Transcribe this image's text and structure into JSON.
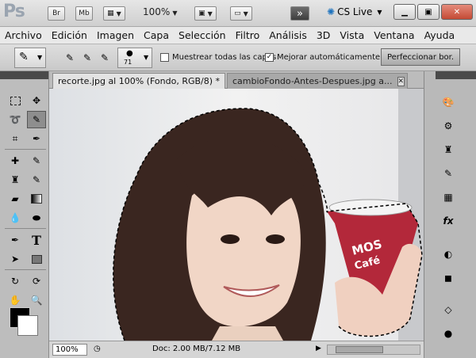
{
  "app": {
    "logo": "Ps",
    "buttons": [
      "Br",
      "Mb"
    ],
    "zoom": "100%",
    "cslive": "CS Live"
  },
  "menu": [
    "Archivo",
    "Edición",
    "Imagen",
    "Capa",
    "Selección",
    "Filtro",
    "Análisis",
    "3D",
    "Vista",
    "Ventana",
    "Ayuda"
  ],
  "options": {
    "brush_size": "71",
    "sample_all_layers": "Muestrear todas las capas",
    "auto_enhance": "Mejorar automáticamente",
    "refine_edge": "Perfeccionar bor."
  },
  "tabs": [
    {
      "label": "recorte.jpg al 100% (Fondo, RGB/8) *"
    },
    {
      "label": "cambioFondo-Antes-Despues.jpg a..."
    }
  ],
  "canvas_text": [
    "MOS",
    "Café"
  ],
  "status": {
    "zoom": "100%",
    "doc": "Doc: 2.00 MB/7.12 MB"
  },
  "colors": {
    "foreground": "#000000",
    "background": "#ffffff",
    "cup_red": "#b3283a"
  }
}
